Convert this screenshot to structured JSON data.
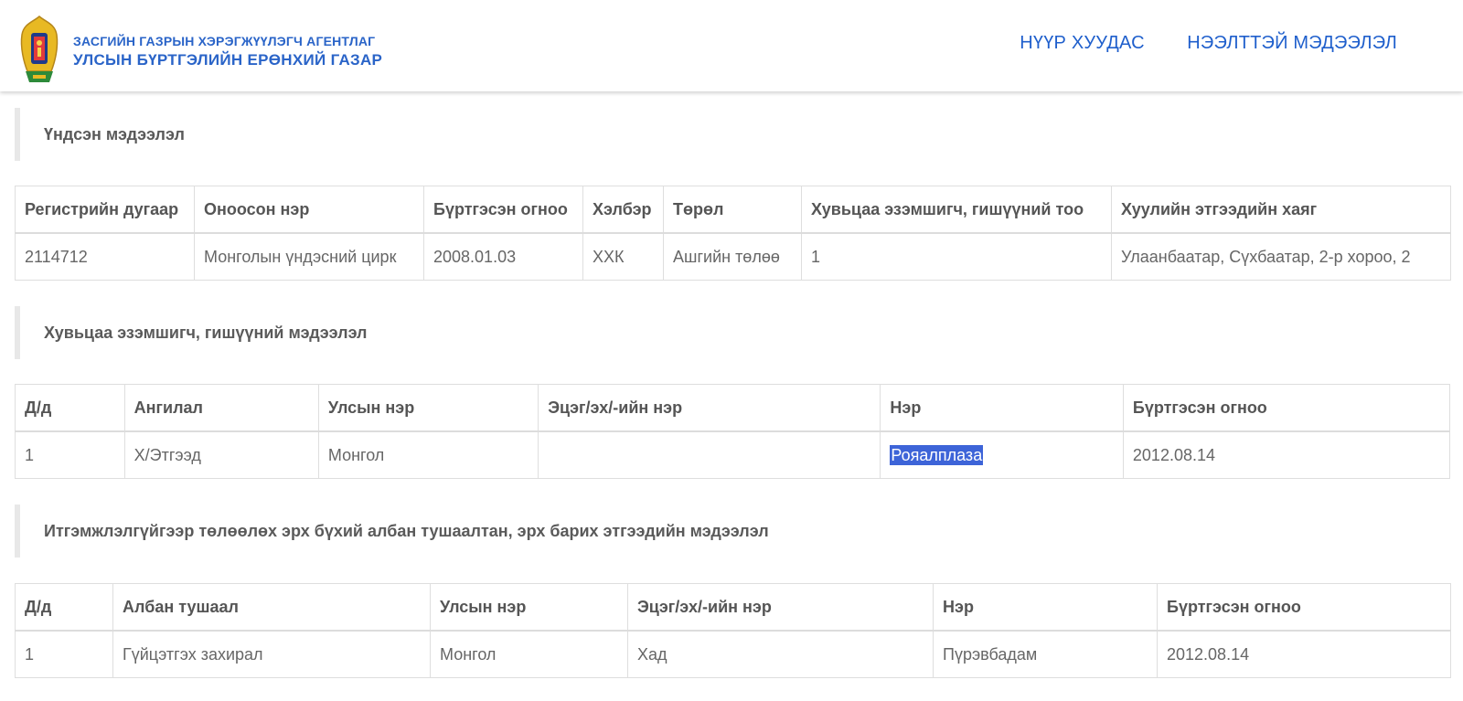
{
  "header": {
    "brand_line1": "ЗАСГИЙН ГАЗРЫН ХЭРЭГЖҮҮЛЭГЧ АГЕНТЛАГ",
    "brand_line2": "УЛСЫН БҮРТГЭЛИЙН ЕРӨНХИЙ ГАЗАР",
    "nav": [
      {
        "label": "НҮҮР ХУУДАС"
      },
      {
        "label": "НЭЭЛТТЭЙ МЭДЭЭЛЭЛ"
      }
    ]
  },
  "sections": [
    {
      "title": "Үндсэн мэдээлэл",
      "headers": [
        "Регистрийн дугаар",
        "Оноосон нэр",
        "Бүртгэсэн огноо",
        "Хэлбэр",
        "Төрөл",
        "Хувьцаа эзэмшигч, гишүүний тоо",
        "Хуулийн этгээдийн хаяг"
      ],
      "rows": [
        [
          "2114712",
          "Монголын үндэсний цирк",
          "2008.01.03",
          "ХХК",
          "Ашгийн төлөө",
          "1",
          "Улаанбаатар, Сүхбаатар, 2-р хороо, 2"
        ]
      ]
    },
    {
      "title": "Хувьцаа эзэмшигч, гишүүний мэдээлэл",
      "headers": [
        "Д/д",
        "Ангилал",
        "Улсын нэр",
        "Эцэг/эх/-ийн нэр",
        "Нэр",
        "Бүртгэсэн огноо"
      ],
      "rows": [
        [
          "1",
          "Х/Этгээд",
          "Монгол",
          "",
          "Рояалплаза",
          "2012.08.14"
        ]
      ]
    },
    {
      "title": "Итгэмжлэлгүйгээр төлөөлөх эрх бүхий албан тушаалтан, эрх барих этгээдийн мэдээлэл",
      "headers": [
        "Д/д",
        "Албан тушаал",
        "Улсын нэр",
        "Эцэг/эх/-ийн нэр",
        "Нэр",
        "Бүртгэсэн огноо"
      ],
      "rows": [
        [
          "1",
          "Гүйцэтгэх захирал",
          "Монгол",
          "Хад",
          "Пүрэвбадам",
          "2012.08.14"
        ]
      ]
    }
  ],
  "colors": {
    "brand_blue": "#2a64c8",
    "nav_blue": "#1f5fcc",
    "selection": "#3d64d8"
  }
}
